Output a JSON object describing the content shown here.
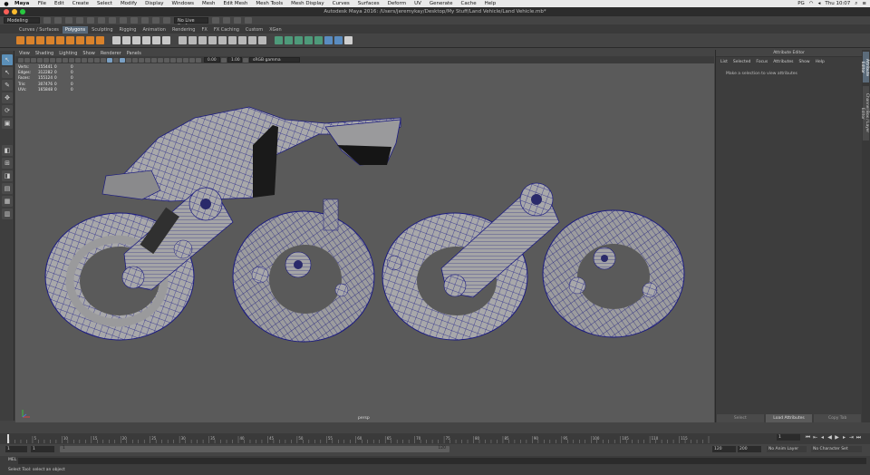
{
  "macos_menu": {
    "app_name": "Maya",
    "items": [
      "File",
      "Edit",
      "Create",
      "Select",
      "Modify",
      "Display",
      "Windows",
      "Mesh",
      "Edit Mesh",
      "Mesh Tools",
      "Mesh Display",
      "Curves",
      "Surfaces",
      "Deform",
      "UV",
      "Generate",
      "Cache",
      "Help"
    ],
    "status": {
      "flag": "PG",
      "clock": "Thu 10:07"
    }
  },
  "window_title": "Autodesk Maya 2016: /Users/jeremykay/Desktop/My Stuff/Land Vehicle/Land Vehicle.mb*",
  "status_line": {
    "mode": "Modeling",
    "live_surface": "No Live Surface"
  },
  "shelf_tabs": [
    {
      "label": "Curves / Surfaces"
    },
    {
      "label": "Polygons",
      "active": true
    },
    {
      "label": "Sculpting"
    },
    {
      "label": "Rigging"
    },
    {
      "label": "Animation"
    },
    {
      "label": "Rendering"
    },
    {
      "label": "FX"
    },
    {
      "label": "FX Caching"
    },
    {
      "label": "Custom"
    },
    {
      "label": "XGen"
    }
  ],
  "panel_menu": [
    "View",
    "Shading",
    "Lighting",
    "Show",
    "Renderer",
    "Panels"
  ],
  "panel_toolbar": {
    "field1": "0.00",
    "field2": "1.00",
    "color_space": "sRGB gamma"
  },
  "hud": [
    {
      "label": "Verts:",
      "v1": "155441",
      "v2": "0",
      "v3": "0"
    },
    {
      "label": "Edges:",
      "v1": "312282",
      "v2": "0",
      "v3": "0"
    },
    {
      "label": "Faces:",
      "v1": "155124",
      "v2": "0",
      "v3": "0"
    },
    {
      "label": "Tris:",
      "v1": "307476",
      "v2": "0",
      "v3": "0"
    },
    {
      "label": "UVs:",
      "v1": "165848",
      "v2": "0",
      "v3": "0"
    }
  ],
  "camera_label": "persp",
  "attribute_editor": {
    "title": "Attribute Editor",
    "menu": [
      "List",
      "Selected",
      "Focus",
      "Attributes",
      "Show",
      "Help"
    ],
    "message": "Make a selection to view attributes",
    "buttons": {
      "select": "Select",
      "load": "Load Attributes",
      "copy_tab": "Copy Tab"
    }
  },
  "side_tabs": [
    "Attribute Editor",
    "Channel Box / Layer Editor"
  ],
  "timeline": {
    "ticks": [
      "5",
      "10",
      "15",
      "20",
      "25",
      "30",
      "35",
      "40",
      "45",
      "50",
      "55",
      "60",
      "65",
      "70",
      "75",
      "80",
      "85",
      "90",
      "95",
      "100",
      "105",
      "110",
      "115",
      "120"
    ],
    "current_frame": "1"
  },
  "range_slider": {
    "start": "1",
    "playback_start": "1",
    "handle_start": "1",
    "handle_end": "120",
    "playback_end": "120",
    "end": "200",
    "anim_layer": "No Anim Layer",
    "character_set": "No Character Set"
  },
  "command_line": {
    "label": "MEL"
  },
  "help_line": "Select Tool: select an object",
  "colors": {
    "viewport_bg": "#5a5a5a",
    "wireframe": "#1c1c80",
    "shaded": "#a6a6a8",
    "accent": "#5b8fb8"
  }
}
